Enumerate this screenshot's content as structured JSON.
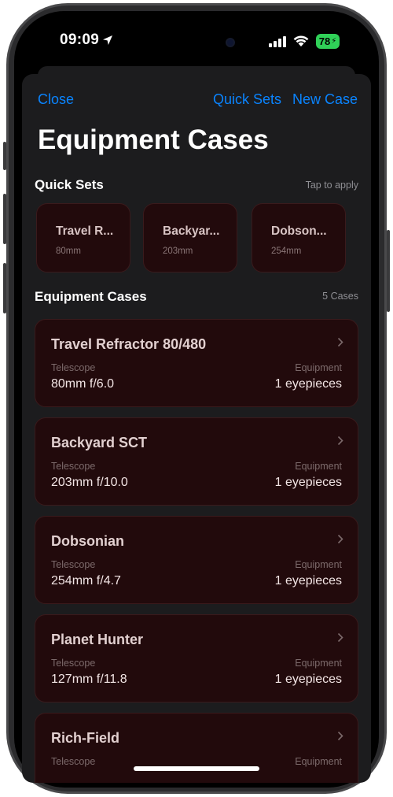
{
  "status_bar": {
    "time": "09:09",
    "battery": "78",
    "location_icon": "location-arrow-icon",
    "signal_icon": "cellular-signal-icon",
    "wifi_icon": "wifi-icon"
  },
  "nav": {
    "close": "Close",
    "quick_sets": "Quick Sets",
    "new_case": "New Case"
  },
  "page_title": "Equipment Cases",
  "quick_sets": {
    "title": "Quick Sets",
    "hint": "Tap to apply",
    "items": [
      {
        "name": "Travel R...",
        "aperture": "80mm"
      },
      {
        "name": "Backyar...",
        "aperture": "203mm"
      },
      {
        "name": "Dobson...",
        "aperture": "254mm"
      }
    ]
  },
  "cases": {
    "title": "Equipment Cases",
    "count": "5 Cases",
    "items": [
      {
        "name": "Travel Refractor 80/480",
        "telescope_label": "Telescope",
        "telescope": "80mm f/6.0",
        "equipment_label": "Equipment",
        "equipment": "1 eyepieces"
      },
      {
        "name": "Backyard SCT",
        "telescope_label": "Telescope",
        "telescope": "203mm f/10.0",
        "equipment_label": "Equipment",
        "equipment": "1 eyepieces"
      },
      {
        "name": "Dobsonian",
        "telescope_label": "Telescope",
        "telescope": "254mm f/4.7",
        "equipment_label": "Equipment",
        "equipment": "1 eyepieces"
      },
      {
        "name": "Planet Hunter",
        "telescope_label": "Telescope",
        "telescope": "127mm f/11.8",
        "equipment_label": "Equipment",
        "equipment": "1 eyepieces"
      },
      {
        "name": "Rich-Field",
        "telescope_label": "Telescope",
        "telescope": "",
        "equipment_label": "Equipment",
        "equipment": ""
      }
    ]
  },
  "colors": {
    "accent": "#0a84ff",
    "card_background": "#220a0c",
    "sheet_background": "#1c1c1e",
    "battery": "#30d158"
  }
}
